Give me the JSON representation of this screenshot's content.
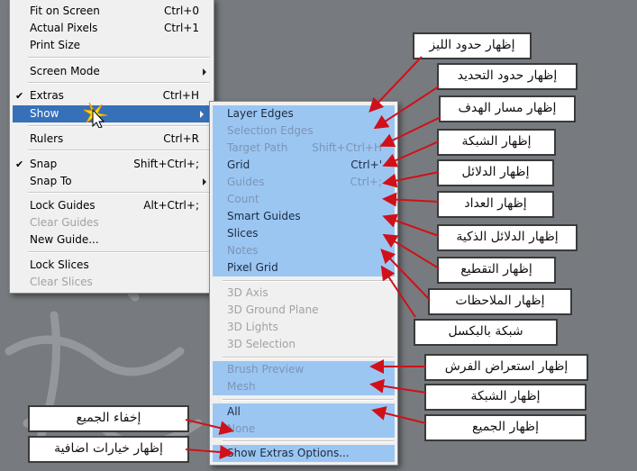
{
  "main_menu": {
    "items": [
      {
        "label": "Fit on Screen",
        "shortcut": "Ctrl+0"
      },
      {
        "label": "Actual Pixels",
        "shortcut": "Ctrl+1"
      },
      {
        "label": "Print Size",
        "shortcut": ""
      },
      {
        "label": "Screen Mode",
        "shortcut": ""
      },
      {
        "label": "Extras",
        "shortcut": "Ctrl+H"
      },
      {
        "label": "Show",
        "shortcut": ""
      },
      {
        "label": "Rulers",
        "shortcut": "Ctrl+R"
      },
      {
        "label": "Snap",
        "shortcut": "Shift+Ctrl+;"
      },
      {
        "label": "Snap To",
        "shortcut": ""
      },
      {
        "label": "Lock Guides",
        "shortcut": "Alt+Ctrl+;"
      },
      {
        "label": "Clear Guides",
        "shortcut": ""
      },
      {
        "label": "New Guide...",
        "shortcut": ""
      },
      {
        "label": "Lock Slices",
        "shortcut": ""
      },
      {
        "label": "Clear Slices",
        "shortcut": ""
      }
    ]
  },
  "show_menu": {
    "items": [
      {
        "label": "Layer Edges",
        "shortcut": ""
      },
      {
        "label": "Selection Edges",
        "shortcut": ""
      },
      {
        "label": "Target Path",
        "shortcut": "Shift+Ctrl+H"
      },
      {
        "label": "Grid",
        "shortcut": "Ctrl+'"
      },
      {
        "label": "Guides",
        "shortcut": "Ctrl+;"
      },
      {
        "label": "Count",
        "shortcut": ""
      },
      {
        "label": "Smart Guides",
        "shortcut": ""
      },
      {
        "label": "Slices",
        "shortcut": ""
      },
      {
        "label": "Notes",
        "shortcut": ""
      },
      {
        "label": "Pixel Grid",
        "shortcut": ""
      },
      {
        "label": "3D Axis",
        "shortcut": ""
      },
      {
        "label": "3D Ground Plane",
        "shortcut": ""
      },
      {
        "label": "3D Lights",
        "shortcut": ""
      },
      {
        "label": "3D Selection",
        "shortcut": ""
      },
      {
        "label": "Brush Preview",
        "shortcut": ""
      },
      {
        "label": "Mesh",
        "shortcut": ""
      },
      {
        "label": "All",
        "shortcut": ""
      },
      {
        "label": "None",
        "shortcut": ""
      },
      {
        "label": "Show Extras Options...",
        "shortcut": ""
      }
    ]
  },
  "annotations": [
    "إظهار حدود الليز",
    "إظهار حدود التحديد",
    "إظهار مسار الهدف",
    "إظهار الشبكة",
    "إظهار الدلائل",
    "إظهار العداد",
    "إظهار الدلائل الذكية",
    "إظهار التقطيع",
    "إظهار الملاحظات",
    "شبكة بالبكسل",
    "إظهار استعراض الفرش",
    "إظهار الشبكة",
    "إظهار الجميع",
    "إخفاء الجميع",
    "إظهار خيارات اضافية"
  ],
  "colors": {
    "background": "#777b7f",
    "menu_bg": "#f0f0f0",
    "highlight": "#3670b8",
    "item_blue": "#9cc6f2",
    "arrow": "#d0101a"
  }
}
